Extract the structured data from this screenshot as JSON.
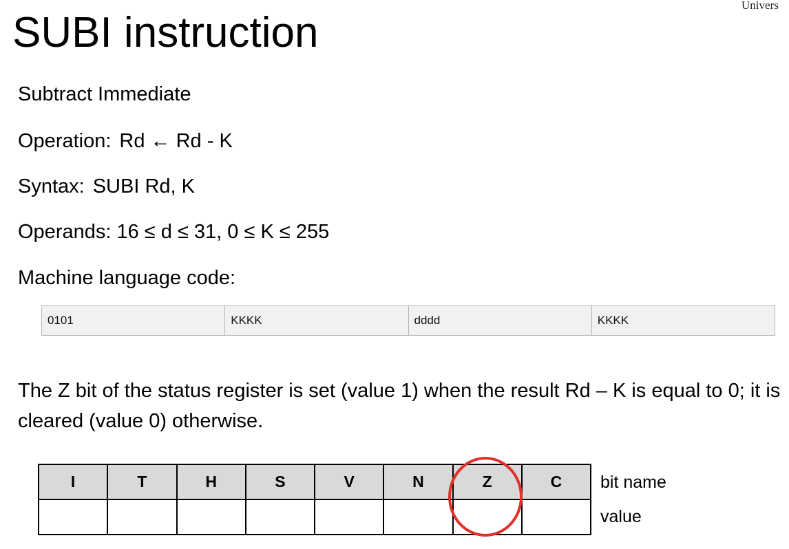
{
  "corner_text": "Univers",
  "title": "SUBI instruction",
  "lines": {
    "description": "Subtract Immediate",
    "operation_label": "Operation:",
    "operation_expr": "Rd ← Rd - K",
    "syntax_label": "Syntax:",
    "syntax_expr": "SUBI Rd, K",
    "operands": "Operands: 16 ≤ d ≤ 31, 0 ≤ K ≤ 255",
    "machine_code_label": "Machine language code:"
  },
  "machine_code": [
    "0101",
    "KKKK",
    "dddd",
    "KKKK"
  ],
  "paragraph": "The Z bit of the status register is set (value 1) when the result Rd – K is equal to 0; it is cleared (value 0) otherwise.",
  "status_register": {
    "bits": [
      "I",
      "T",
      "H",
      "S",
      "V",
      "N",
      "Z",
      "C"
    ],
    "values": [
      "",
      "",
      "",
      "",
      "",
      "",
      "",
      ""
    ],
    "row_label_names": "bit name",
    "row_label_values": "value",
    "highlighted_bit": "Z",
    "highlight_color": "#e0302a",
    "header_fill": "#d9d9d9"
  }
}
